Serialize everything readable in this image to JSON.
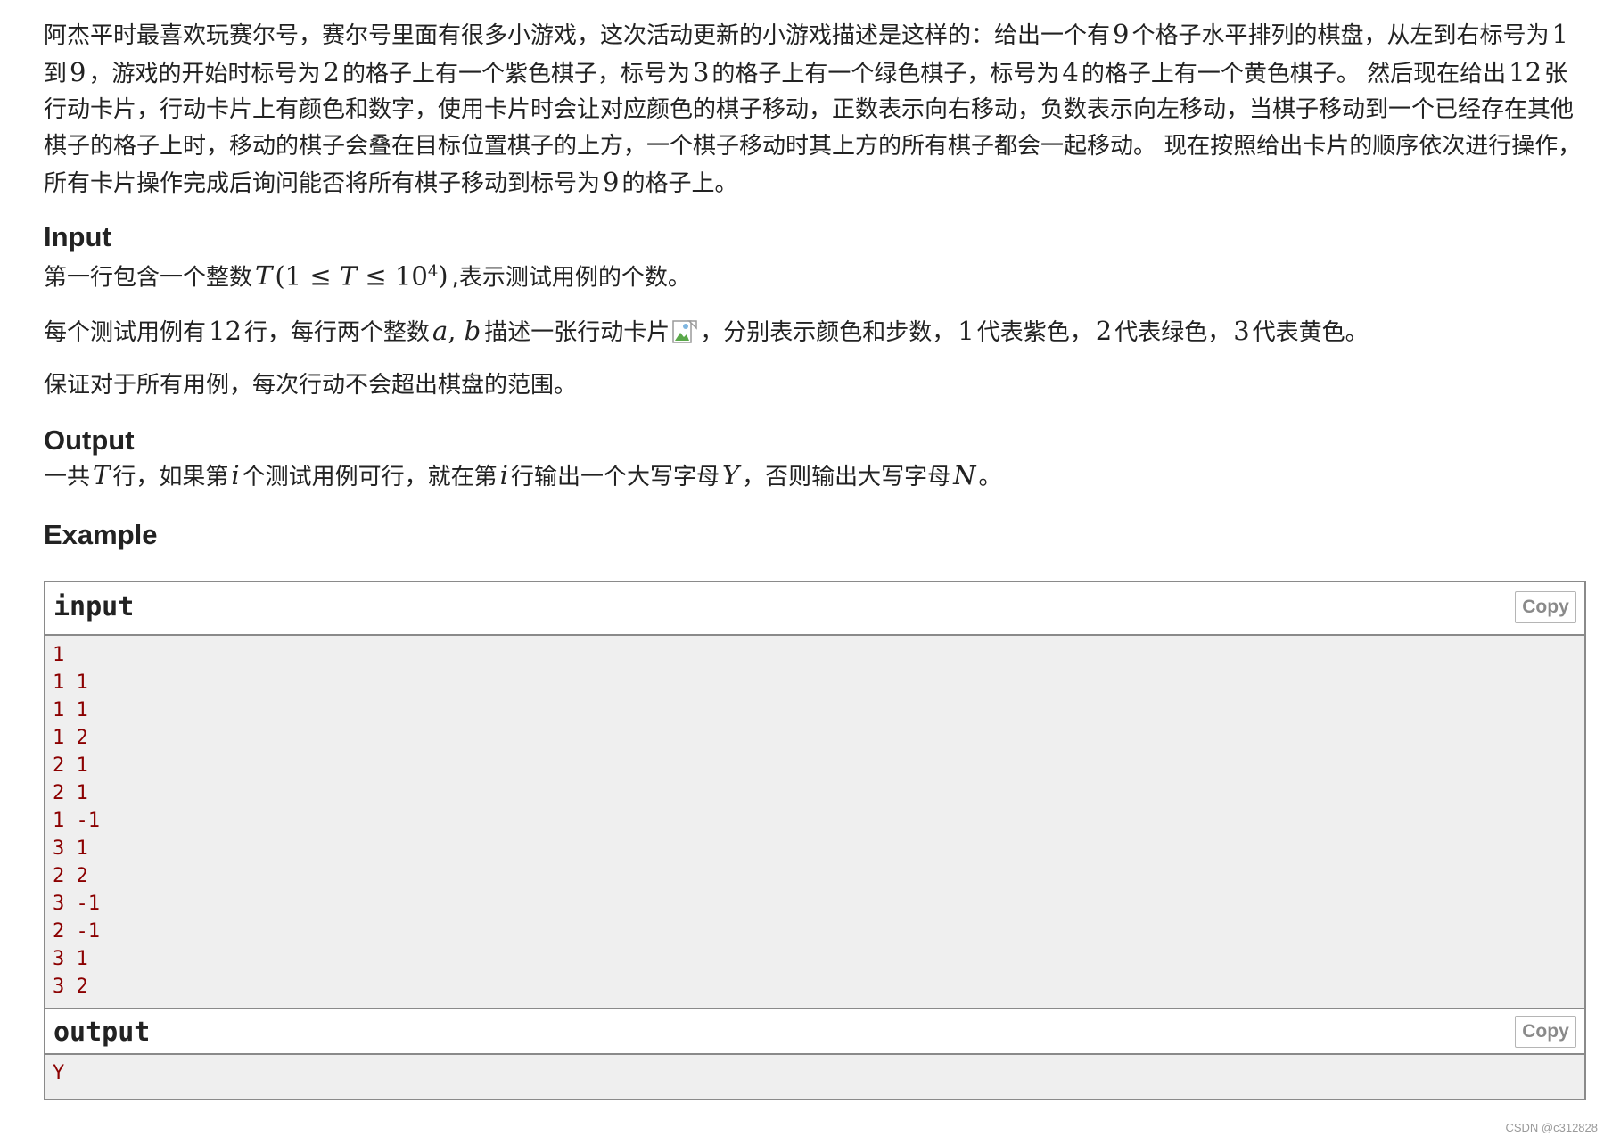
{
  "statement": {
    "p1_a": "阿杰平时最喜欢玩赛尔号，赛尔号里面有很多小游戏，这次活动更新的小游戏描述是这样的：给出一个有",
    "p1_n9": "9",
    "p1_b": "个格子水平排列的棋盘，从左到右标号为",
    "p1_n1": "1",
    "p1_c": "到",
    "p1_n9b": "9",
    "p1_d": "，游戏的开始时标号为",
    "p1_n2": "2",
    "p1_e": "的格子上有一个紫色棋子，标号为",
    "p1_n3": "3",
    "p1_f": "的格子上有一个绿色棋子，标号为",
    "p1_n4": "4",
    "p1_g": "的格子上有一个黄色棋子。 然后现在给出",
    "p1_n12": "12",
    "p1_h": "张行动卡片，行动卡片上有颜色和数字，使用卡片时会让对应颜色的棋子移动，正数表示向右移动，负数表示向左移动，当棋子移动到一个已经存在其他棋子的格子上时，移动的棋子会叠在目标位置棋子的上方，一个棋子移动时其上方的所有棋子都会一起移动。 现在按照给出卡片的顺序依次进行操作，所有卡片操作完成后询问能否将所有棋子移动到标号为",
    "p1_n9c": "9",
    "p1_i": "的格子上。"
  },
  "input_section": {
    "title": "Input",
    "l1_a": "第一行包含一个整数",
    "l1_T": "T",
    "l1_open": "(1 ≤ ",
    "l1_T2": "T",
    "l1_le": " ≤ 10",
    "l1_exp": "4",
    "l1_close": ")",
    "l1_b": ",表示测试用例的个数。",
    "l2_a": "每个测试用例有",
    "l2_n12": "12",
    "l2_b": "行，每行两个整数",
    "l2_a_var": "a",
    "l2_comma": ", ",
    "l2_b_var": "b",
    "l2_c": "描述一张行动卡片",
    "l2_d": "，分别表示颜色和步数，",
    "l2_n1": "1",
    "l2_e": "代表紫色，",
    "l2_n2": "2",
    "l2_f": "代表绿色，",
    "l2_n3": "3",
    "l2_g": "代表黄色。",
    "l3": "保证对于所有用例，每次行动不会超出棋盘的范围。"
  },
  "output_section": {
    "title": "Output",
    "a": "一共",
    "T": "T",
    "b": "行，如果第",
    "i1": "i",
    "c": "个测试用例可行，就在第",
    "i2": "i",
    "d": "行输出一个大写字母",
    "Y": "Y",
    "e": "，否则输出大写字母",
    "N": "N",
    "f": "。"
  },
  "example": {
    "title": "Example",
    "input_label": "input",
    "output_label": "output",
    "copy_label": "Copy",
    "input_lines": [
      "1",
      "1 1",
      "1 1",
      "1 2",
      "2 1",
      "2 1",
      "1 -1",
      "3 1",
      "2 2",
      "3 -1",
      "2 -1",
      "3 1",
      "3 2"
    ],
    "output_lines": [
      "Y"
    ]
  },
  "watermark": "CSDN @c312828"
}
